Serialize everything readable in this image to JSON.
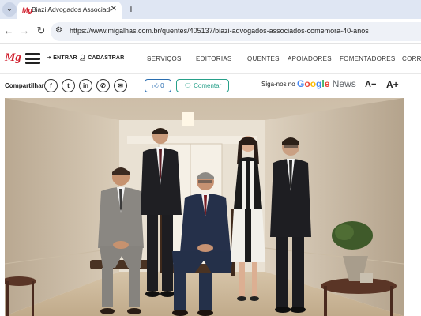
{
  "browser": {
    "tab_title": "Biazi Advogados Associados co",
    "tab_favicon": "Mg",
    "new_tab_label": "+",
    "url": "https://www.migalhas.com.br/quentes/405137/biazi-advogados-associados-comemora-40-anos"
  },
  "header": {
    "logo": "Mg",
    "login_label": "ENTRAR",
    "register_label": "CADASTRAR",
    "nav": [
      {
        "label": "SERVIÇOS",
        "dropdown": true
      },
      {
        "label": "EDITORIAS",
        "dropdown": true
      },
      {
        "label": "QUENTES"
      },
      {
        "label": "APOIADORES"
      },
      {
        "label": "FOMENTADORES"
      },
      {
        "label": "CORRE"
      }
    ]
  },
  "sharebar": {
    "share_label": "Compartilhar",
    "share_icons": [
      "facebook-icon",
      "twitter-icon",
      "linkedin-icon",
      "whatsapp-icon",
      "email-icon"
    ],
    "like_count": "0",
    "comment_label": "Comentar",
    "follow_label": "Siga-nos no",
    "google_news": {
      "google": "Google",
      "news": "News"
    },
    "font_decrease": "A−",
    "font_increase": "A+"
  },
  "colors": {
    "brand_red": "#d0202e",
    "like_blue": "#2a6db0",
    "comment_green": "#27a08a",
    "google_blue": "#4285f4",
    "google_red": "#ea4335",
    "google_yellow": "#fbbc05",
    "google_green": "#34a853"
  }
}
